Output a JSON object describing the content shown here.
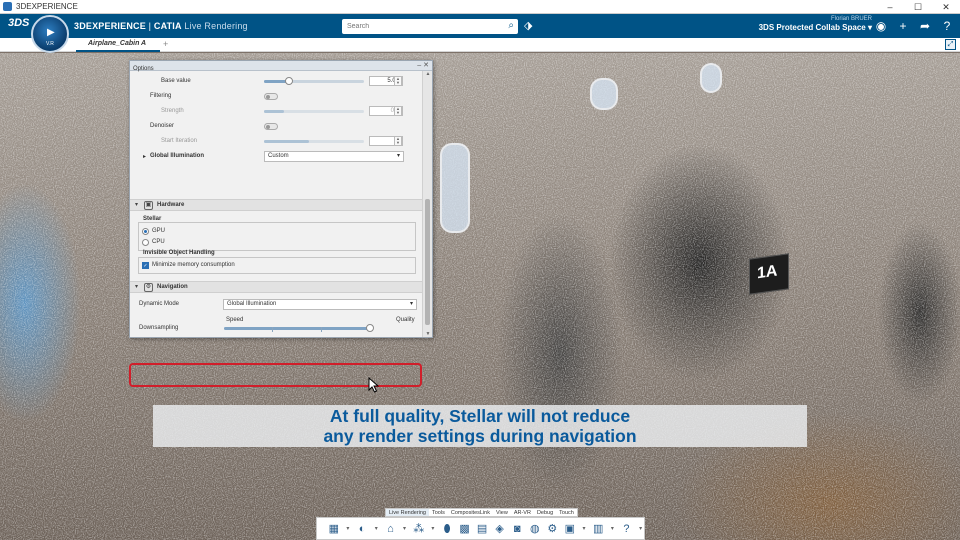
{
  "window": {
    "title": "3DEXPERIENCE",
    "controls": [
      "–",
      "☐",
      "✕"
    ]
  },
  "topbar": {
    "brand_bold": "3DEXPERIENCE",
    "brand_sep": " | ",
    "brand_app": "CATIA",
    "brand_sub": " Live Rendering",
    "search_placeholder": "Search",
    "user_name": "Florian BRUER",
    "space": "3DS Protected Collab Space ▾",
    "logo": "3DS"
  },
  "compass": {
    "version": "V.R"
  },
  "tabs": [
    {
      "label": "Airplane_Cabin A"
    }
  ],
  "tab_add": "+",
  "options": {
    "title": "Options",
    "controls": "– ✕",
    "rows": {
      "base_value": {
        "label": "Base value",
        "value": "5.00",
        "fraction": 0.25
      },
      "filtering": {
        "label": "Filtering"
      },
      "strength": {
        "label": "Strength",
        "value": "0.2",
        "fraction": 0.2
      },
      "denoiser": {
        "label": "Denoiser"
      },
      "start_iteration": {
        "label": "Start Iteration",
        "value": "8",
        "fraction": 0.45
      },
      "global_illumination": {
        "label": "Global Illumination",
        "value": "Custom"
      }
    },
    "hardware": {
      "title": "Hardware",
      "stellar_label": "Stellar",
      "gpu": "GPU",
      "cpu": "CPU",
      "invisible_label": "Invisible Object Handling",
      "minimize": "Minimize memory consumption"
    },
    "navigation": {
      "title": "Navigation",
      "dynamic_mode_label": "Dynamic Mode",
      "dynamic_mode_value": "Global Illumination",
      "downsampling_label": "Downsampling",
      "speed": "Speed",
      "quality": "Quality",
      "downsampling_fraction": 1.0
    }
  },
  "caption": {
    "line1": "At full quality, Stellar will not reduce",
    "line2": "any render settings during navigation"
  },
  "actionbar": {
    "tabs": [
      "Live Rendering",
      "Tools",
      "CompositesLink",
      "View",
      "AR-VR",
      "Debug",
      "Touch"
    ],
    "active_tab": "Live Rendering"
  },
  "viewport": {
    "seat_label": "1A"
  },
  "colors": {
    "brand": "#005386",
    "highlight": "#d11e2a",
    "caption_text": "#0a5a9c"
  }
}
